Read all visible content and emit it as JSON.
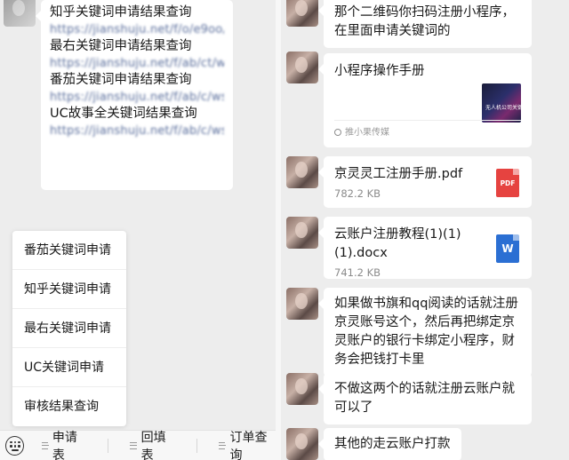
{
  "left_chat": {
    "link_message": [
      {
        "title": "知乎关键词申请结果查询",
        "url": "https://jianshuju.net/f/o/e9oo/ws/s/3Oktlu"
      },
      {
        "title": "最右关键词申请结果查询",
        "url": "https://jianshuju.net/f/ab/ct/ws/Uhk/1te"
      },
      {
        "title": "番茄关键词申请结果查询",
        "url": "https://jianshuju.net/f/ab/c/ws/s/T7rJpe"
      },
      {
        "title": "UC故事全关键词结果查询",
        "url": "https://jianshuju.net/f/ab/c/ws/s/1ek"
      }
    ],
    "popup_menu": [
      "番茄关键词申请",
      "知乎关键词申请",
      "最右关键词申请",
      "UC关键词申请",
      "审核结果查询"
    ],
    "bottom_menu": [
      "申请表",
      "回填表",
      "订单查询"
    ]
  },
  "right_chat": {
    "msg_qrcode": "那个二维码你扫码注册小程序，在里面申请关键词的",
    "mini_program": {
      "title": "小程序操作手册",
      "thumb_text": "无人机公司关键词申请",
      "source": "推小果传媒"
    },
    "file_1": {
      "name": "京灵灵工注册手册.pdf",
      "size": "782.2 KB",
      "icon": "PDF"
    },
    "file_2": {
      "name": "云账户注册教程(1)(1)(1).docx",
      "size": "741.2 KB",
      "icon": "W"
    },
    "msg_bank": "如果做书旗和qq阅读的话就注册京灵账号这个，然后再把绑定京灵账户的银行卡绑定小程序，财务会把钱打卡里",
    "msg_cloud": "不做这两个的话就注册云账户就可以了",
    "msg_other": "其他的走云账户打款"
  }
}
